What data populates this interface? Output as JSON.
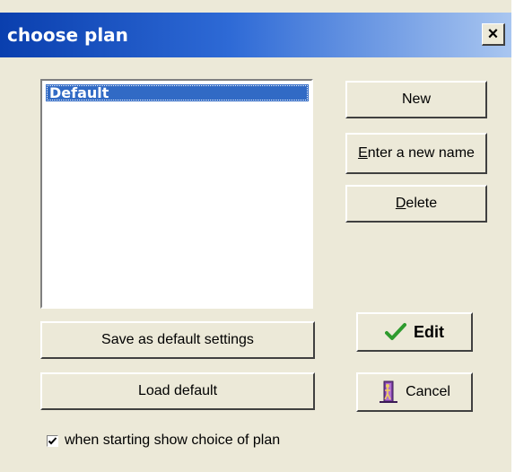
{
  "window": {
    "title": "choose plan",
    "close_glyph": "×",
    "close_icon": "close-icon"
  },
  "plans": {
    "items": [
      {
        "label": "Default",
        "selected": true
      }
    ]
  },
  "buttons": {
    "new_label": "New",
    "rename_mnemonic": "E",
    "rename_rest": "nter a new name",
    "delete_mnemonic": "D",
    "delete_rest": "elete",
    "save_default_label": "Save as default settings",
    "edit_label": "Edit",
    "edit_icon": "checkmark-icon",
    "load_default_label": "Load default",
    "cancel_label": "Cancel",
    "cancel_icon": "door-exit-icon"
  },
  "startup_option": {
    "label": "when starting show choice of plan",
    "checked": true
  },
  "colors": {
    "title_gradient_start": "#0a3fae",
    "title_gradient_end": "#a9c6f0",
    "dialog_bg": "#ece9d8",
    "selection": "#316ac5",
    "edit_check": "#2e9b2e",
    "cancel_icon": "#7a3fa0"
  }
}
